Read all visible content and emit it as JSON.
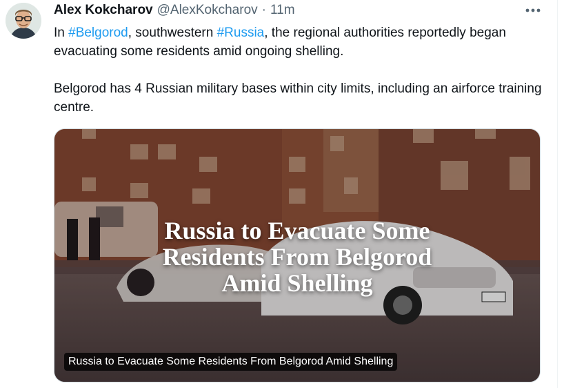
{
  "author": {
    "name": "Alex Kokcharov",
    "handle": "@AlexKokcharov",
    "separator": "·",
    "time": "11m"
  },
  "tweet": {
    "p1_before": "In ",
    "hashtag1": "#Belgorod",
    "p1_mid": ", southwestern ",
    "hashtag2": "#Russia",
    "p1_after": ", the regional authorities reportedly began evacuating some residents amid ongoing shelling.",
    "p2": "Belgorod has 4 Russian military bases within city limits, including an airforce training centre."
  },
  "card": {
    "headline_lines": [
      "Russia to Evacuate Some",
      "Residents From Belgorod",
      "Amid Shelling"
    ],
    "caption": "Russia to Evacuate Some Residents From Belgorod Amid Shelling"
  },
  "icons": {
    "more": "more-horizontal-icon",
    "avatar": "avatar"
  },
  "colors": {
    "link": "#1d9bf0",
    "text": "#0f1419",
    "muted": "#536471"
  }
}
